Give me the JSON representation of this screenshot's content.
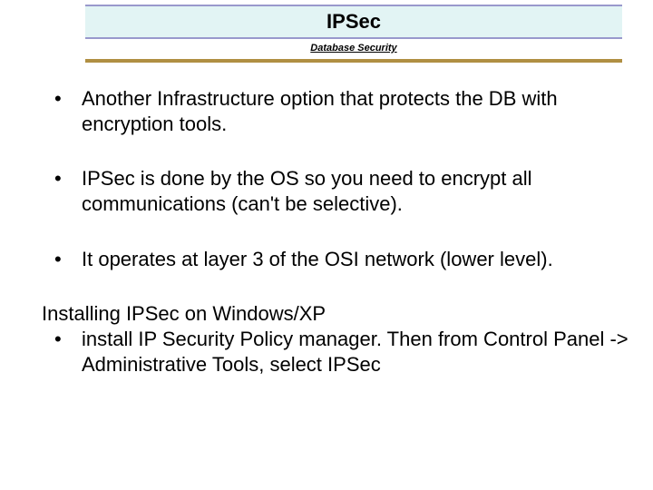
{
  "header": {
    "title": "IPSec",
    "subtitle": "Database Security"
  },
  "content": {
    "bullets_main": [
      "Another Infrastructure option that protects the DB with encryption tools.",
      "IPSec is  done by the OS so you need to encrypt all communications (can't be selective).",
      "It operates at layer 3 of the OSI network (lower level)."
    ],
    "paragraph": "Installing IPSec on Windows/XP",
    "bullets_sub": [
      "install IP Security Policy manager. Then from Control Panel -> Administrative Tools, select IPSec"
    ]
  }
}
